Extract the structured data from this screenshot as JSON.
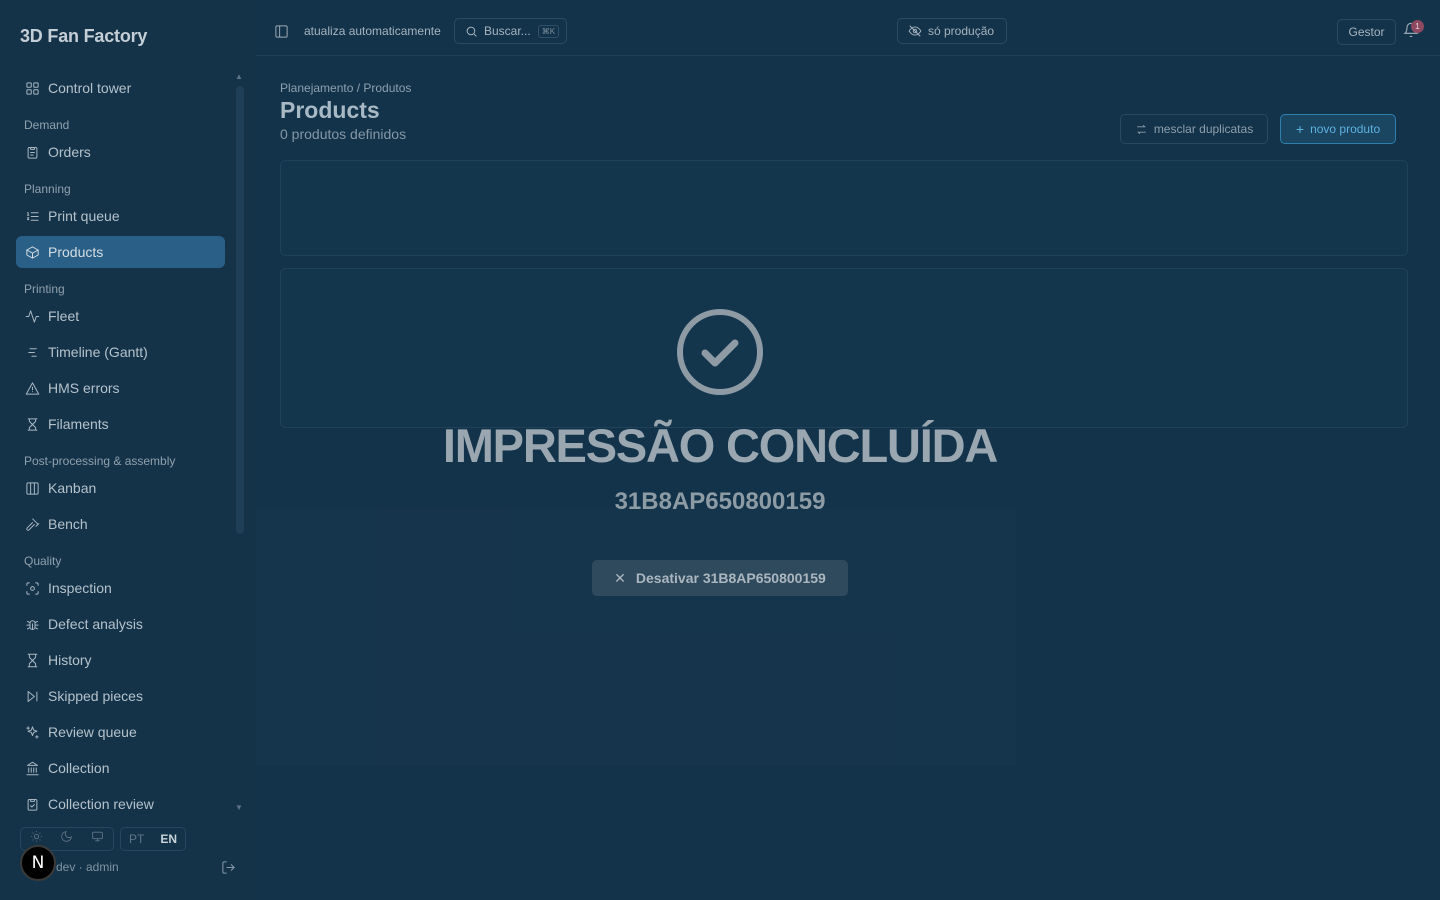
{
  "app": {
    "brand": "3D Fan Factory"
  },
  "sidebar": {
    "items": [
      {
        "type": "item",
        "label": "Control tower",
        "icon": "grid-icon",
        "active": false
      },
      {
        "type": "group",
        "label": "Demand"
      },
      {
        "type": "item",
        "label": "Orders",
        "icon": "clipboard-icon",
        "active": false
      },
      {
        "type": "group",
        "label": "Planning"
      },
      {
        "type": "item",
        "label": "Print queue",
        "icon": "list-ordered-icon",
        "active": false
      },
      {
        "type": "item",
        "label": "Products",
        "icon": "package-icon",
        "active": true
      },
      {
        "type": "group",
        "label": "Printing"
      },
      {
        "type": "item",
        "label": "Fleet",
        "icon": "activity-icon",
        "active": false
      },
      {
        "type": "item",
        "label": "Timeline (Gantt)",
        "icon": "gantt-icon",
        "active": false
      },
      {
        "type": "item",
        "label": "HMS errors",
        "icon": "warning-icon",
        "active": false
      },
      {
        "type": "item",
        "label": "Filaments",
        "icon": "spool-icon",
        "active": false
      },
      {
        "type": "group",
        "label": "Post-processing & assembly"
      },
      {
        "type": "item",
        "label": "Kanban",
        "icon": "columns-icon",
        "active": false
      },
      {
        "type": "item",
        "label": "Bench",
        "icon": "hammer-icon",
        "active": false
      },
      {
        "type": "group",
        "label": "Quality"
      },
      {
        "type": "item",
        "label": "Inspection",
        "icon": "scan-icon",
        "active": false
      },
      {
        "type": "item",
        "label": "Defect analysis",
        "icon": "bug-icon",
        "active": false
      },
      {
        "type": "item",
        "label": "History",
        "icon": "hourglass-icon",
        "active": false
      },
      {
        "type": "item",
        "label": "Skipped pieces",
        "icon": "skip-icon",
        "active": false
      },
      {
        "type": "item",
        "label": "Review queue",
        "icon": "sparkles-icon",
        "active": false
      },
      {
        "type": "item",
        "label": "Collection",
        "icon": "landmark-icon",
        "active": false
      },
      {
        "type": "item",
        "label": "Collection review",
        "icon": "clipboard-check-icon",
        "active": false
      }
    ],
    "lang": {
      "pt": "PT",
      "en": "EN",
      "selected": "EN"
    },
    "user": "dev · admin",
    "badge_letter": "N"
  },
  "header": {
    "auto_refresh": "atualiza automaticamente",
    "search_placeholder": "Buscar...",
    "search_shortcut": "⌘K",
    "production_toggle": "só produção",
    "role": "Gestor",
    "notifications": "1"
  },
  "main": {
    "breadcrumb": "Planejamento / Produtos",
    "title": "Products",
    "subtitle": "0 produtos definidos",
    "merge_label": "mesclar duplicatas",
    "new_label": "novo produto"
  },
  "overlay": {
    "title": "IMPRESSÃO CONCLUÍDA",
    "serial": "31B8AP650800159",
    "disable_label": "Desativar 31B8AP650800159"
  },
  "colors": {
    "accent": "#2a6088",
    "primary_button": "#5fb1e2",
    "background": "#13334a"
  }
}
